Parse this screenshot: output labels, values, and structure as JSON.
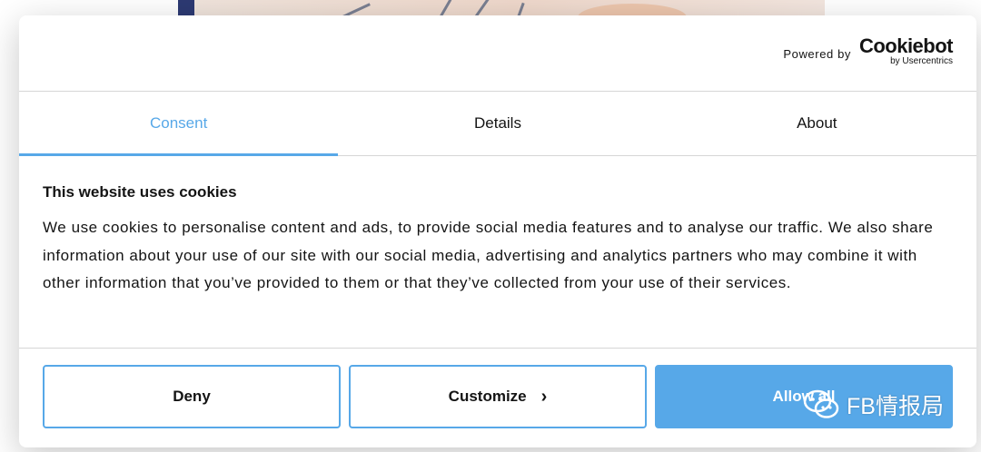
{
  "header": {
    "powered_by": "Powered by",
    "logo_main": "Cookiebot",
    "logo_sub": "by Usercentrics"
  },
  "tabs": [
    {
      "label": "Consent",
      "active": true
    },
    {
      "label": "Details",
      "active": false
    },
    {
      "label": "About",
      "active": false
    }
  ],
  "content": {
    "heading": "This website uses cookies",
    "body": "We use cookies to personalise content and ads, to provide social media features and to analyse our traffic. We also share information about your use of our site with our social media, advertising and analytics partners who may combine it with other information that you’ve provided to them or that they’ve collected from your use of their services."
  },
  "buttons": {
    "deny": "Deny",
    "customize": "Customize",
    "allow_all": "Allow all"
  },
  "watermark": {
    "text": "FB情报局",
    "icon": "wechat-icon"
  },
  "colors": {
    "accent": "#57a8e8",
    "text": "#141414",
    "divider": "#d6d6d6"
  }
}
